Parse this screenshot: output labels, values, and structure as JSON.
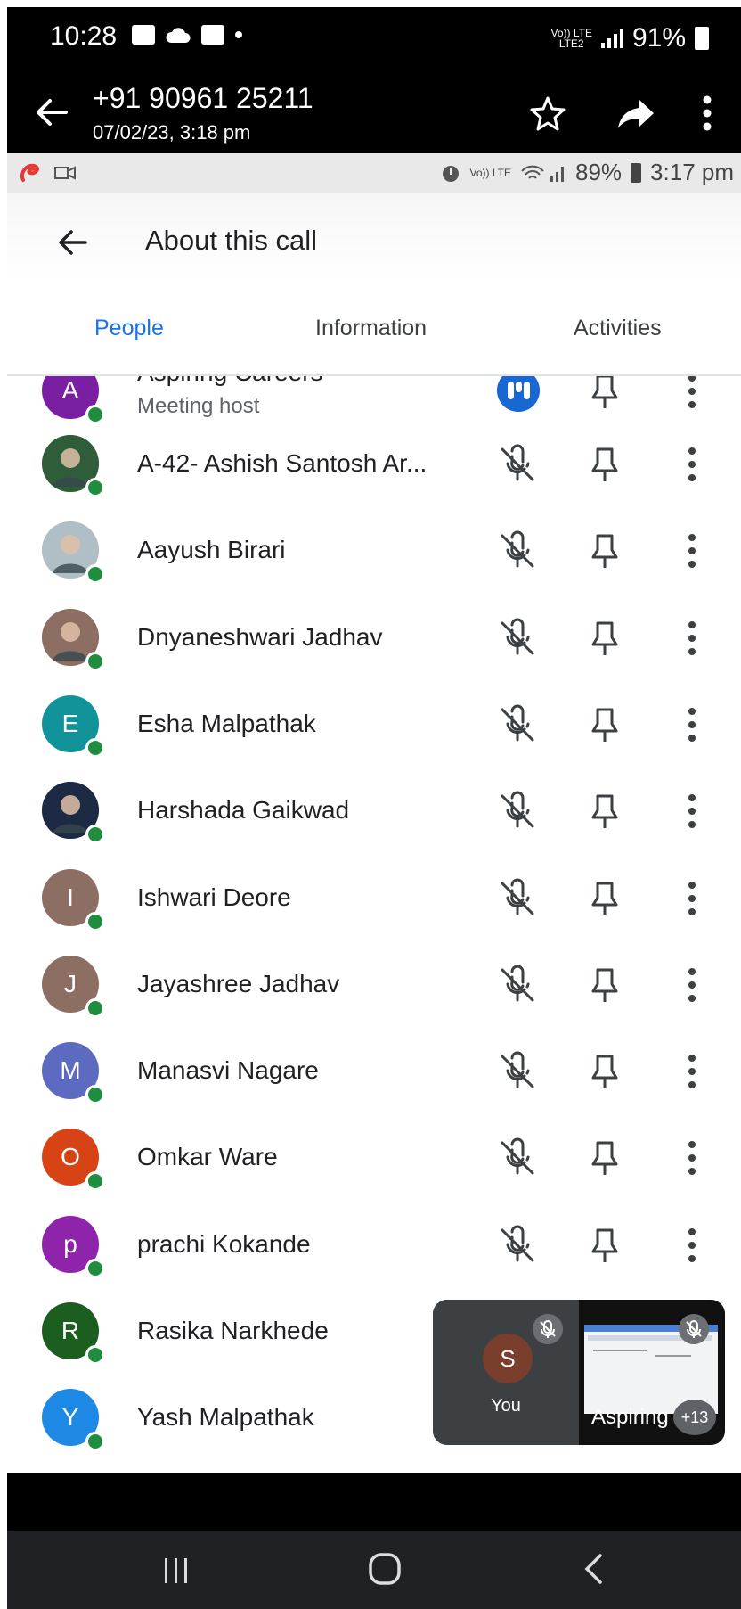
{
  "outer_status": {
    "time": "10:28",
    "net_top": "Vo)) LTE",
    "net_bottom": "LTE2",
    "battery": "91%"
  },
  "outer_appbar": {
    "phone": "+91 90961 25211",
    "date": "07/02/23, 3:18 pm"
  },
  "inner_status": {
    "network": "Vo)) LTE",
    "battery": "89%",
    "time": "3:17 pm"
  },
  "header": {
    "title": "About this call"
  },
  "tabs": [
    {
      "label": "People"
    },
    {
      "label": "Information"
    },
    {
      "label": "Activities"
    }
  ],
  "host": {
    "initial": "A",
    "name": "Aspiring Careers",
    "role": "Meeting host",
    "color": "#7b1fa2"
  },
  "participants": [
    {
      "name": "A-42- Ashish Santosh Ar...",
      "initial": "",
      "color": "#2f5d3a"
    },
    {
      "name": "Aayush Birari",
      "initial": "",
      "color": "#b0bec5"
    },
    {
      "name": "Dnyaneshwari Jadhav",
      "initial": "",
      "color": "#8d6e63"
    },
    {
      "name": "Esha Malpathak",
      "initial": "E",
      "color": "#12939a"
    },
    {
      "name": "Harshada Gaikwad",
      "initial": "",
      "color": "#1c2a44"
    },
    {
      "name": "Ishwari Deore",
      "initial": "I",
      "color": "#8d6e63"
    },
    {
      "name": "Jayashree Jadhav",
      "initial": "J",
      "color": "#8d6e63"
    },
    {
      "name": "Manasvi Nagare",
      "initial": "M",
      "color": "#5c6bc0"
    },
    {
      "name": "Omkar Ware",
      "initial": "O",
      "color": "#d84315"
    },
    {
      "name": "prachi Kokande",
      "initial": "p",
      "color": "#8e24aa"
    },
    {
      "name": "Rasika Narkhede",
      "initial": "R",
      "color": "#1b5e20"
    },
    {
      "name": "Yash Malpathak",
      "initial": "Y",
      "color": "#1e88e5"
    }
  ],
  "pip": {
    "self_initial": "S",
    "self_label": "You",
    "share_label": "Aspiring",
    "more_count": "+13"
  }
}
